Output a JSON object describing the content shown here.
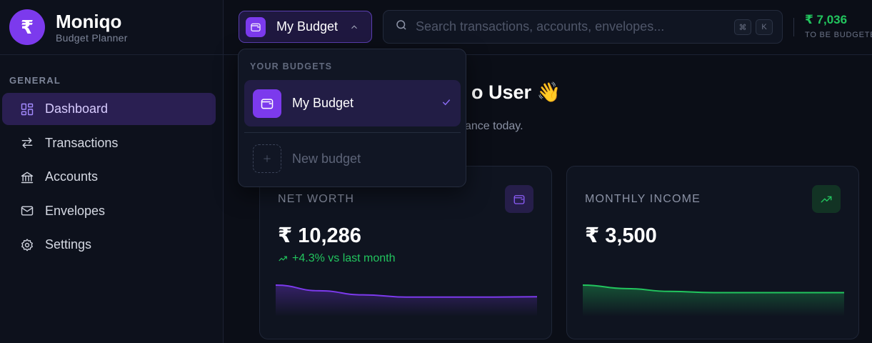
{
  "brand": {
    "logo_glyph": "₹",
    "name": "Moniqo",
    "subtitle": "Budget Planner"
  },
  "sidebar": {
    "section_label": "GENERAL",
    "items": [
      {
        "label": "Dashboard",
        "icon": "dashboard-icon",
        "active": true
      },
      {
        "label": "Transactions",
        "icon": "arrows-swap-icon",
        "active": false
      },
      {
        "label": "Accounts",
        "icon": "bank-icon",
        "active": false
      },
      {
        "label": "Envelopes",
        "icon": "mail-icon",
        "active": false
      },
      {
        "label": "Settings",
        "icon": "gear-icon",
        "active": false
      }
    ]
  },
  "topbar": {
    "budget_selector_label": "My Budget",
    "search_placeholder": "Search transactions, accounts, envelopes...",
    "shortcut_keys": [
      "⌘",
      "K"
    ],
    "to_be_budgeted_amount": "₹ 7,036",
    "to_be_budgeted_label": "TO BE BUDGETED"
  },
  "dropdown": {
    "heading": "YOUR BUDGETS",
    "items": [
      {
        "label": "My Budget",
        "selected": true
      }
    ],
    "new_label": "New budget"
  },
  "main": {
    "greeting_visible": "o User 👋",
    "subgreeting_visible": "ance today."
  },
  "cards": [
    {
      "title": "NET WORTH",
      "value": "₹ 10,286",
      "change": "+4.3% vs last month",
      "icon": "wallet-icon",
      "accent": "#7c3aed",
      "spark": [
        0.0,
        0.18,
        0.31,
        0.38,
        0.38,
        0.38,
        0.37
      ]
    },
    {
      "title": "MONTHLY INCOME",
      "value": "₹ 3,500",
      "change": "",
      "icon": "trending-up-icon",
      "accent": "#22c55e",
      "spark": [
        0.0,
        0.11,
        0.2,
        0.24,
        0.24,
        0.24,
        0.24
      ]
    }
  ],
  "colors": {
    "accent": "#7c3aed",
    "positive": "#22c55e",
    "background": "#0b0e17"
  }
}
